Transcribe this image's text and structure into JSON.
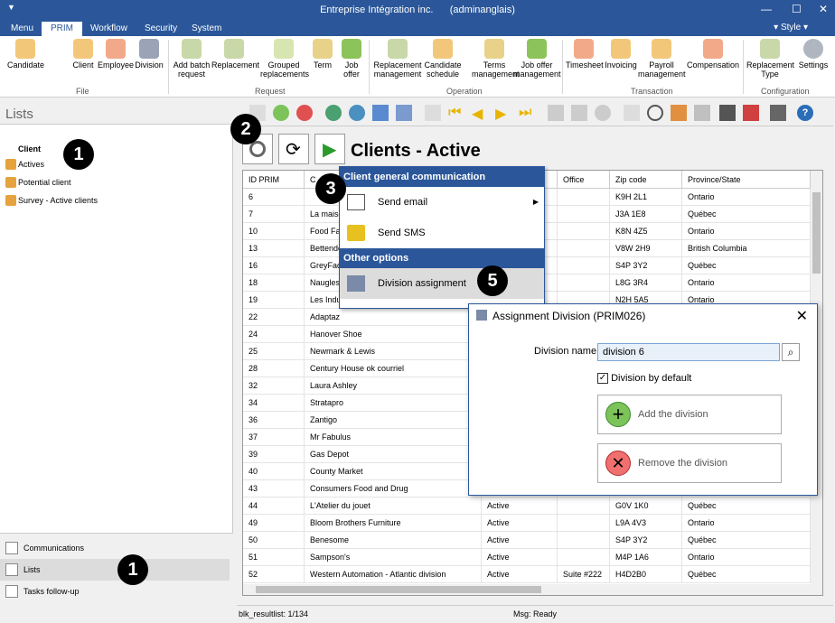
{
  "window": {
    "title": "Entreprise Intégration inc.",
    "user": "(adminanglais)"
  },
  "ribbon_tabs": [
    "Menu",
    "PRIM",
    "Workflow",
    "Security",
    "System"
  ],
  "style_label": "Style",
  "ribbon": {
    "buttons": [
      "Candidate",
      "Client",
      "Employee",
      "Division",
      "Add batch request",
      "Replacement",
      "Grouped replacements",
      "Term",
      "Job offer",
      "Replacement management",
      "Candidate schedule",
      "Terms management",
      "Job offer management",
      "Timesheet",
      "Invoicing",
      "Payroll management",
      "Compensation",
      "Replacement Type",
      "Settings"
    ],
    "groups": [
      "File",
      "Request",
      "Operation",
      "Transaction",
      "Configuration"
    ]
  },
  "left": {
    "title": "Lists",
    "tree_header": "Client",
    "tree": [
      "Actives",
      "Potential client",
      "Survey - Active clients"
    ],
    "nav": [
      "Communications",
      "Lists",
      "Tasks follow-up"
    ]
  },
  "page_title": "Clients - Active",
  "grid": {
    "columns": [
      "ID PRIM",
      "C",
      "",
      "Office",
      "Zip code",
      "Province/State"
    ],
    "rows": [
      [
        "6",
        "",
        "",
        "",
        "K9H 2L1",
        "Ontario"
      ],
      [
        "7",
        "La maiso",
        "",
        "",
        "J3A 1E8",
        "Québec"
      ],
      [
        "10",
        "Food Fai",
        "",
        "",
        "K8N 4Z5",
        "Ontario"
      ],
      [
        "13",
        "Bettendo",
        "",
        "",
        "V8W 2H9",
        "British Columbia"
      ],
      [
        "16",
        "GreyFad",
        "",
        "",
        "S4P 3Y2",
        "Québec"
      ],
      [
        "18",
        "Naugles",
        "",
        "",
        "L8G 3R4",
        "Ontario"
      ],
      [
        "19",
        "Les Indu",
        "",
        "",
        "N2H 5A5",
        "Ontario"
      ],
      [
        "22",
        "Adaptaz",
        "",
        "",
        "",
        ""
      ],
      [
        "24",
        "Hanover Shoe",
        "",
        "",
        "",
        ""
      ],
      [
        "25",
        "Newmark & Lewis",
        "",
        "",
        "",
        ""
      ],
      [
        "28",
        "Century House ok courriel",
        "",
        "",
        "",
        ""
      ],
      [
        "32",
        "Laura Ashley",
        "",
        "",
        "",
        ""
      ],
      [
        "34",
        "Stratapro",
        "",
        "",
        "",
        ""
      ],
      [
        "36",
        "Zantigo",
        "",
        "",
        "",
        ""
      ],
      [
        "37",
        "Mr Fabulus",
        "",
        "",
        "",
        ""
      ],
      [
        "39",
        "Gas Depot",
        "",
        "",
        "",
        ""
      ],
      [
        "40",
        "County Market",
        "",
        "",
        "",
        ""
      ],
      [
        "43",
        "Consumers Food and Drug",
        "",
        "",
        "",
        ""
      ],
      [
        "44",
        "L'Atelier du jouet",
        "Active",
        "",
        "G0V 1K0",
        "Québec"
      ],
      [
        "49",
        "Bloom Brothers Furniture",
        "Active",
        "",
        "L9A 4V3",
        "Ontario"
      ],
      [
        "50",
        "Benesome",
        "Active",
        "",
        "S4P 3Y2",
        "Québec"
      ],
      [
        "51",
        "Sampson's",
        "Active",
        "",
        "M4P 1A6",
        "Ontario"
      ],
      [
        "52",
        "Western Automation - Atlantic division",
        "Active",
        "Suite #222",
        "H4D2B0",
        "Québec"
      ]
    ]
  },
  "status": {
    "left": "blk_resultlist: 1/134",
    "right": "Msg: Ready"
  },
  "context_menu": {
    "header1": "Client general communication",
    "items1": [
      "Send email",
      "Send SMS"
    ],
    "header2": "Other options",
    "items2": [
      "Division assignment"
    ]
  },
  "dialog": {
    "title": "Assignment Division (PRIM026)",
    "label": "Division name",
    "value": "division 6",
    "checkbox": "Division by default",
    "add": "Add the division",
    "remove": "Remove the division"
  },
  "callouts": [
    "1",
    "1",
    "2",
    "3",
    "5"
  ],
  "colors": {
    "accent": "#2b579a"
  }
}
